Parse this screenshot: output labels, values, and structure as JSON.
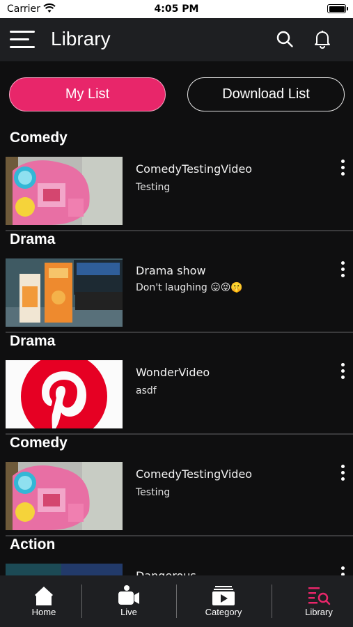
{
  "status_bar": {
    "carrier": "Carrier",
    "time": "4:05 PM"
  },
  "header": {
    "title": "Library"
  },
  "segments": {
    "my_list": "My List",
    "download_list": "Download List",
    "active": "my_list"
  },
  "sections": [
    {
      "category": "Comedy",
      "video_title": "ComedyTestingVideo",
      "subtitle": "Testing",
      "thumb": "toy-pink"
    },
    {
      "category": "Drama",
      "video_title": "Drama show",
      "subtitle": "Don't laughing 😛😝🤫",
      "thumb": "juice-boxes"
    },
    {
      "category": "Drama",
      "video_title": "WonderVideo",
      "subtitle": "asdf",
      "thumb": "pinterest-logo"
    },
    {
      "category": "Comedy",
      "video_title": "ComedyTestingVideo",
      "subtitle": "Testing",
      "thumb": "toy-pink"
    },
    {
      "category": "Action",
      "video_title": "Dangerous",
      "subtitle": "",
      "thumb": "teal-dark"
    }
  ],
  "tabbar": {
    "tabs": [
      {
        "label": "Home",
        "icon": "home-icon"
      },
      {
        "label": "Live",
        "icon": "live-camera-icon"
      },
      {
        "label": "Category",
        "icon": "category-play-icon"
      },
      {
        "label": "Library",
        "icon": "library-search-icon"
      }
    ],
    "active_index": 3,
    "active_color": "#e8266a"
  },
  "colors": {
    "accent": "#e8266a",
    "header_bg": "#1e1f22",
    "page_bg": "#0f0f10"
  }
}
